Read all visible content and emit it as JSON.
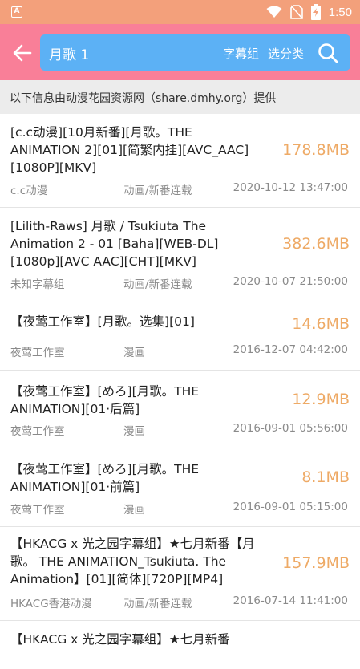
{
  "status_bar": {
    "app_badge": "A",
    "time": "1:50"
  },
  "header": {
    "search_query": "月歌 1",
    "subtitle_group_label": "字幕组",
    "category_label": "选分类"
  },
  "info_text": "以下信息由动漫花园资源网（share.dmhy.org）提供",
  "colors": {
    "status_bar": "#f3a07b",
    "header": "#f97f98",
    "search_box": "#5cb1f5",
    "size_text": "#eeaa66"
  },
  "results": [
    {
      "title": "[c.c动漫][10月新番][月歌。THE ANIMATION 2][01][简繁内挂][AVC_AAC][1080P][MKV]",
      "size": "178.8MB",
      "group": "c.c动漫",
      "category": "动画/新番连载",
      "date": "2020-10-12 13:47:00"
    },
    {
      "title": "[Lilith-Raws] 月歌 / Tsukiuta The Animation 2 - 01 [Baha][WEB-DL][1080p][AVC AAC][CHT][MKV]",
      "size": "382.6MB",
      "group": "未知字幕组",
      "category": "动画/新番连载",
      "date": "2020-10-07 21:50:00"
    },
    {
      "title": "【夜莺工作室】[月歌。选集][01]",
      "size": "14.6MB",
      "group": "夜莺工作室",
      "category": "漫画",
      "date": "2016-12-07 04:42:00"
    },
    {
      "title": "【夜莺工作室】[めろ][月歌。THE ANIMATION][01·后篇]",
      "size": "12.9MB",
      "group": "夜莺工作室",
      "category": "漫画",
      "date": "2016-09-01 05:56:00"
    },
    {
      "title": "【夜莺工作室】[めろ][月歌。THE ANIMATION][01·前篇]",
      "size": "8.1MB",
      "group": "夜莺工作室",
      "category": "漫画",
      "date": "2016-09-01 05:15:00"
    },
    {
      "title": "【HKACG x 光之园字幕组】★七月新番【月歌。 THE ANIMATION_Tsukiuta. The Animation】[01][简体][720P][MP4]",
      "size": "157.9MB",
      "group": "HKACG香港动漫",
      "category": "动画/新番连载",
      "date": "2016-07-14 11:41:00"
    },
    {
      "title": "【HKACG x 光之园字幕组】★七月新番",
      "size": "",
      "group": "",
      "category": "",
      "date": ""
    }
  ]
}
